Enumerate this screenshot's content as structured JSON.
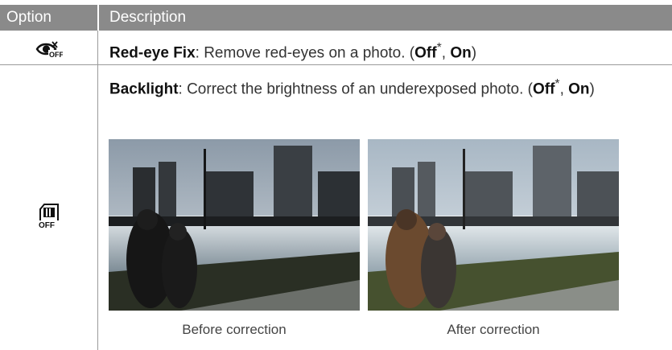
{
  "table": {
    "header": {
      "option": "Option",
      "description": "Description"
    },
    "rows": [
      {
        "icon": "red-eye-fix-off-icon",
        "name": "Red-eye Fix",
        "text": ": Remove red-eyes on a photo. (",
        "opt_default": "Off",
        "opt_default_mark": "*",
        "opt_sep": ", ",
        "opt_other": "On",
        "close": ")"
      },
      {
        "icon": "backlight-off-icon",
        "name": "Backlight",
        "text": ": Correct the brightness of an underexposed photo. (",
        "opt_default": "Off",
        "opt_default_mark": "*",
        "opt_sep": ", ",
        "opt_other": "On",
        "close": ")",
        "images": [
          {
            "caption": "Before correction"
          },
          {
            "caption": "After correction"
          }
        ]
      }
    ]
  }
}
